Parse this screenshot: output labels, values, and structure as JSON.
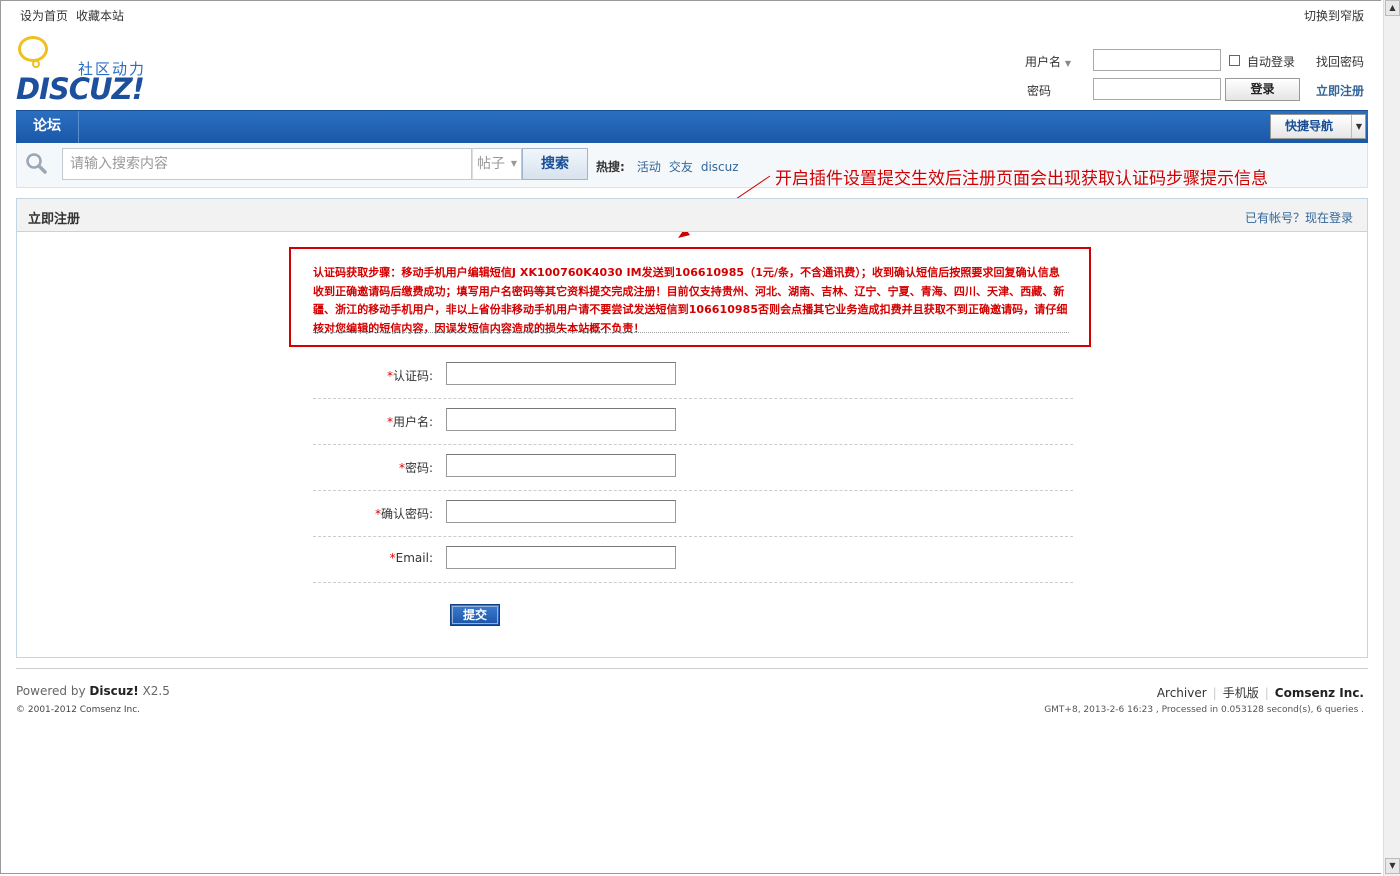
{
  "top_links": {
    "set_home": "设为首页",
    "bookmark": "收藏本站",
    "switch_width": "切换到窄版"
  },
  "logo": {
    "slogan": "社区动力",
    "brand": "DISCUZ!"
  },
  "login": {
    "username_label": "用户名",
    "auto_login_label": "自动登录",
    "find_password": "找回密码",
    "password_label": "密码",
    "login_button": "登录",
    "register_link": "立即注册"
  },
  "nav": {
    "forum": "论坛",
    "quick_nav": "快捷导航"
  },
  "search": {
    "placeholder": "请输入搜索内容",
    "type": "帖子",
    "button": "搜索",
    "hot_label": "热搜:",
    "hot_items": [
      "活动",
      "交友",
      "discuz"
    ]
  },
  "annotation": "开启插件设置提交生效后注册页面会出现获取认证码步骤提示信息",
  "panel": {
    "title": "立即注册",
    "login_link": "已有帐号？现在登录",
    "notice": "认证码获取步骤：移动手机用户编辑短信J XK100760K4030 IM发送到106610985（1元/条，不含通讯费）；收到确认短信后按照要求回复确认信息收到正确邀请码后缴费成功；填写用户名密码等其它资料提交完成注册！目前仅支持贵州、河北、湖南、吉林、辽宁、宁夏、青海、四川、天津、西藏、新疆、浙江的移动手机用户，非以上省份非移动手机用户请不要尝试发送短信到106610985否则会点播其它业务造成扣费并且获取不到正确邀请码，请仔细核对您编辑的短信内容，因误发短信内容造成的损失本站概不负责！"
  },
  "form": {
    "required_mark": "*",
    "fields": [
      {
        "label": "认证码:"
      },
      {
        "label": "用户名:"
      },
      {
        "label": "密码:"
      },
      {
        "label": "确认密码:"
      },
      {
        "label": "Email:"
      }
    ],
    "submit": "提交"
  },
  "footer": {
    "powered_prefix": "Powered by ",
    "powered_brand": "Discuz!",
    "powered_version": " X2.5",
    "copyright": "© 2001-2012 Comsenz Inc.",
    "links": [
      "Archiver",
      "手机版"
    ],
    "company": "Comsenz Inc.",
    "processed": "GMT+8, 2013-2-6 16:23 , Processed in 0.053128 second(s), 6 queries ."
  },
  "colors": {
    "nav_blue": "#1a58a8",
    "notice_red": "#d40000",
    "link": "#336699"
  }
}
